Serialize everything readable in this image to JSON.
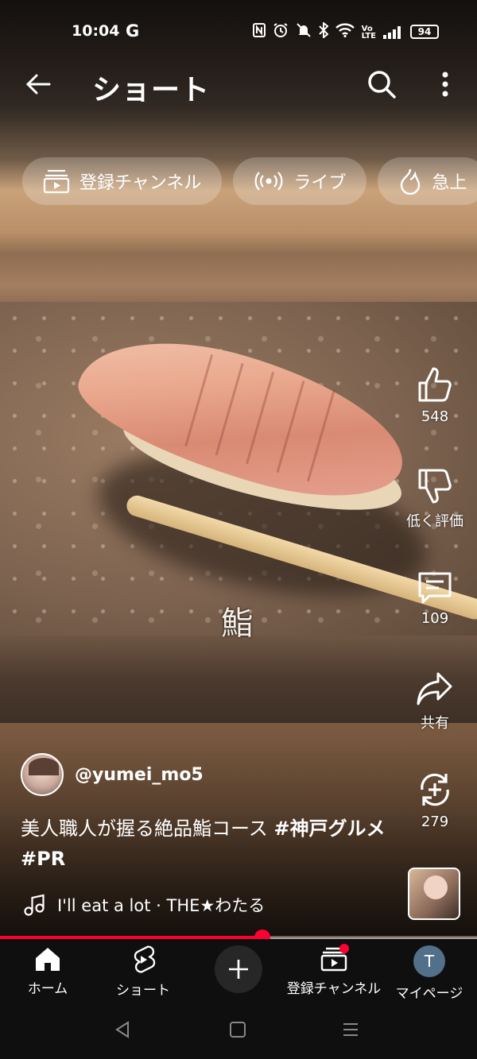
{
  "status_bar": {
    "time": "10:04",
    "google_indicator": "G",
    "battery": "94",
    "icons": [
      "nfc-icon",
      "alarm-icon",
      "mute-icon",
      "bluetooth-icon",
      "wifi-icon",
      "volte-icon",
      "signal-icon",
      "battery-icon"
    ]
  },
  "header": {
    "title": "ショート"
  },
  "chips": [
    {
      "label": "登録チャンネル",
      "icon": "subscriptions-icon"
    },
    {
      "label": "ライブ",
      "icon": "live-icon"
    },
    {
      "label": "急上",
      "icon": "trending-icon"
    }
  ],
  "video": {
    "overlay_text": "鮨",
    "channel": "@yumei_mo5",
    "caption_text": "美人職人が握る絶品鮨コース",
    "caption_tags": [
      "#神戸グルメ",
      "#PR"
    ],
    "music": "I'll eat a lot · THE★わたる",
    "progress": 0.55
  },
  "actions": {
    "like": "548",
    "dislike": "低く評価",
    "comments": "109",
    "share": "共有",
    "remix": "279"
  },
  "bottom_nav": {
    "home": "ホーム",
    "shorts": "ショート",
    "subscriptions": "登録チャンネル",
    "you": "マイページ",
    "avatar_letter": "T"
  },
  "colors": {
    "accent": "#ff0033",
    "nav_bg": "#0f0f0f"
  }
}
